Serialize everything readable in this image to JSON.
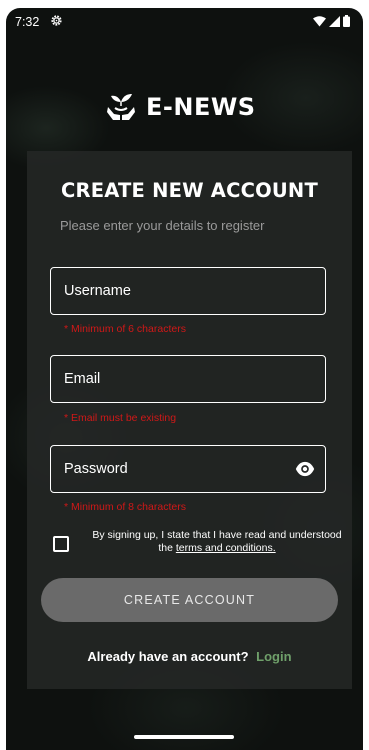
{
  "status_bar": {
    "time": "7:32"
  },
  "app": {
    "logo_text": "E-NEWS"
  },
  "form": {
    "title": "CREATE NEW ACCOUNT",
    "subtitle": "Please enter your details to register",
    "username": {
      "label": "Username",
      "hint": "* Minimum of 6 characters"
    },
    "email": {
      "label": "Email",
      "hint": "* Email must be existing"
    },
    "password": {
      "label": "Password",
      "hint": "* Minimum of 8 characters"
    },
    "consent": {
      "text": "By signing up, I state that I have read and understood the ",
      "link": "terms and conditions."
    },
    "submit_label": "CREATE ACCOUNT",
    "login_prompt": "Already have an account?",
    "login_link": "Login"
  },
  "colors": {
    "background": "#0e110f",
    "card": "#262827",
    "error": "#d01818",
    "accent_link": "#6fa06a",
    "button": "#6a6a6a"
  }
}
